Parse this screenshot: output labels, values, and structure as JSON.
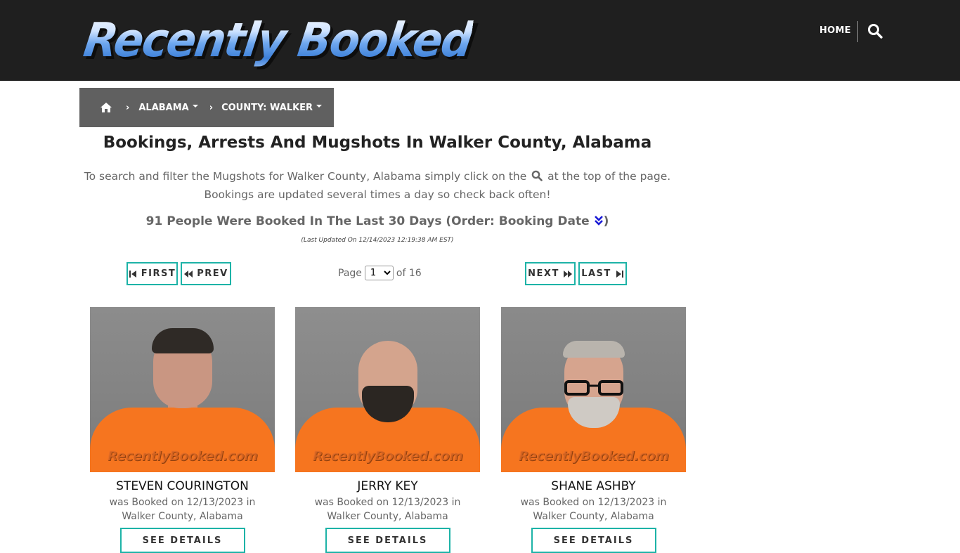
{
  "header": {
    "logo_text": "Recently Booked",
    "nav_home": "HOME",
    "search_icon": "search-icon"
  },
  "breadcrumb": {
    "home_icon": "home-icon",
    "state": "ALABAMA",
    "county": "COUNTY: WALKER"
  },
  "main": {
    "title": "Bookings, Arrests And Mugshots In Walker County, Alabama",
    "intro_part1": "To search and filter the Mugshots for Walker County, Alabama simply click on the",
    "intro_part2": "at the top of the page.",
    "intro_line2": "Bookings are updated several times a day so check back often!",
    "count_text": "91 People Were Booked In The Last 30 Days (Order: Booking Date",
    "count_close": ")",
    "last_updated": "(Last Updated On 12/14/2023 12:19:38 AM EST)"
  },
  "pagination": {
    "first_label": "FIRST",
    "prev_label": "PREV",
    "next_label": "NEXT",
    "last_label": "LAST",
    "page_prefix": "Page",
    "page_value": "1",
    "page_suffix": "of 16"
  },
  "bookings": [
    {
      "name": "STEVEN COURINGTON",
      "line1": "was Booked on 12/13/2023 in",
      "line2": "Walker County, Alabama",
      "button": "SEE DETAILS",
      "watermark": "RecentlyBooked.com"
    },
    {
      "name": "JERRY KEY",
      "line1": "was Booked on 12/13/2023 in",
      "line2": "Walker County, Alabama",
      "button": "SEE DETAILS",
      "watermark": "RecentlyBooked.com"
    },
    {
      "name": "SHANE ASHBY",
      "line1": "was Booked on 12/13/2023 in",
      "line2": "Walker County, Alabama",
      "button": "SEE DETAILS",
      "watermark": "RecentlyBooked.com"
    }
  ],
  "colors": {
    "header_bg": "#1f1f1f",
    "breadcrumb_bg": "#606060",
    "accent_teal": "#1db3a7",
    "shirt_orange": "#f6751f"
  }
}
